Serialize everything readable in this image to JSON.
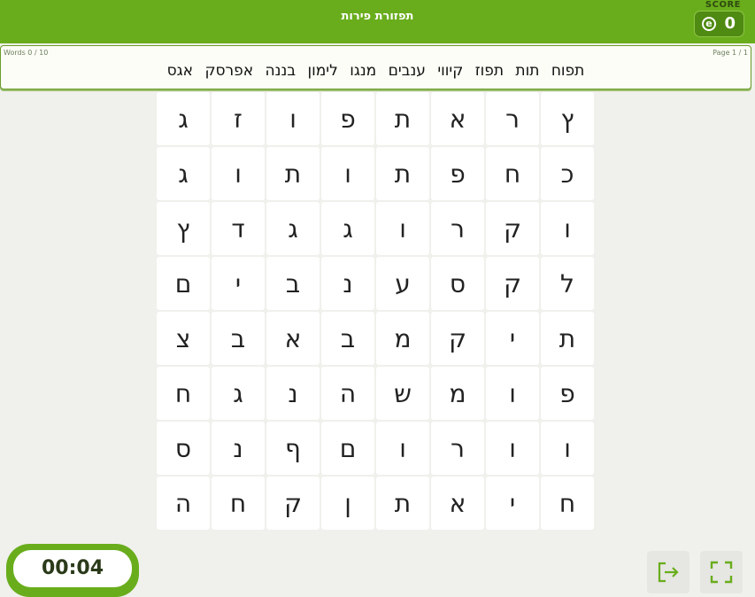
{
  "header": {
    "title": "תפזורת פירות",
    "score_label": "SCORE",
    "score_icon": "e",
    "score_value": "0"
  },
  "word_panel": {
    "words_count": "Words 0 / 10",
    "page_count": "Page 1 / 1",
    "words": [
      "תפוח",
      "תות",
      "תפוז",
      "קיווי",
      "ענבים",
      "מנגו",
      "לימון",
      "בננה",
      "אפרסק",
      "אגס"
    ]
  },
  "grid": [
    [
      "ץ",
      "ר",
      "א",
      "ת",
      "פ",
      "ו",
      "ז",
      "ג"
    ],
    [
      "כ",
      "ח",
      "פ",
      "ת",
      "ו",
      "ת",
      "ו",
      "ג"
    ],
    [
      "ו",
      "ק",
      "ר",
      "ו",
      "ג",
      "ג",
      "ד",
      "ץ"
    ],
    [
      "ל",
      "ק",
      "ס",
      "ע",
      "נ",
      "ב",
      "י",
      "ם"
    ],
    [
      "ת",
      "י",
      "ק",
      "מ",
      "ב",
      "א",
      "ב",
      "צ"
    ],
    [
      "פ",
      "ו",
      "מ",
      "ש",
      "ה",
      "נ",
      "ג",
      "ח"
    ],
    [
      "ו",
      "ו",
      "ר",
      "ו",
      "ם",
      "ף",
      "נ",
      "ס"
    ],
    [
      "ח",
      "י",
      "א",
      "ת",
      "ן",
      "ק",
      "ח",
      "ה"
    ]
  ],
  "timer": {
    "value": "00:04"
  },
  "controls": {
    "exit_icon": "exit-icon",
    "fullscreen_icon": "fullscreen-icon"
  },
  "colors": {
    "accent": "#69ad1c",
    "accent_dark": "#4f8a12"
  }
}
